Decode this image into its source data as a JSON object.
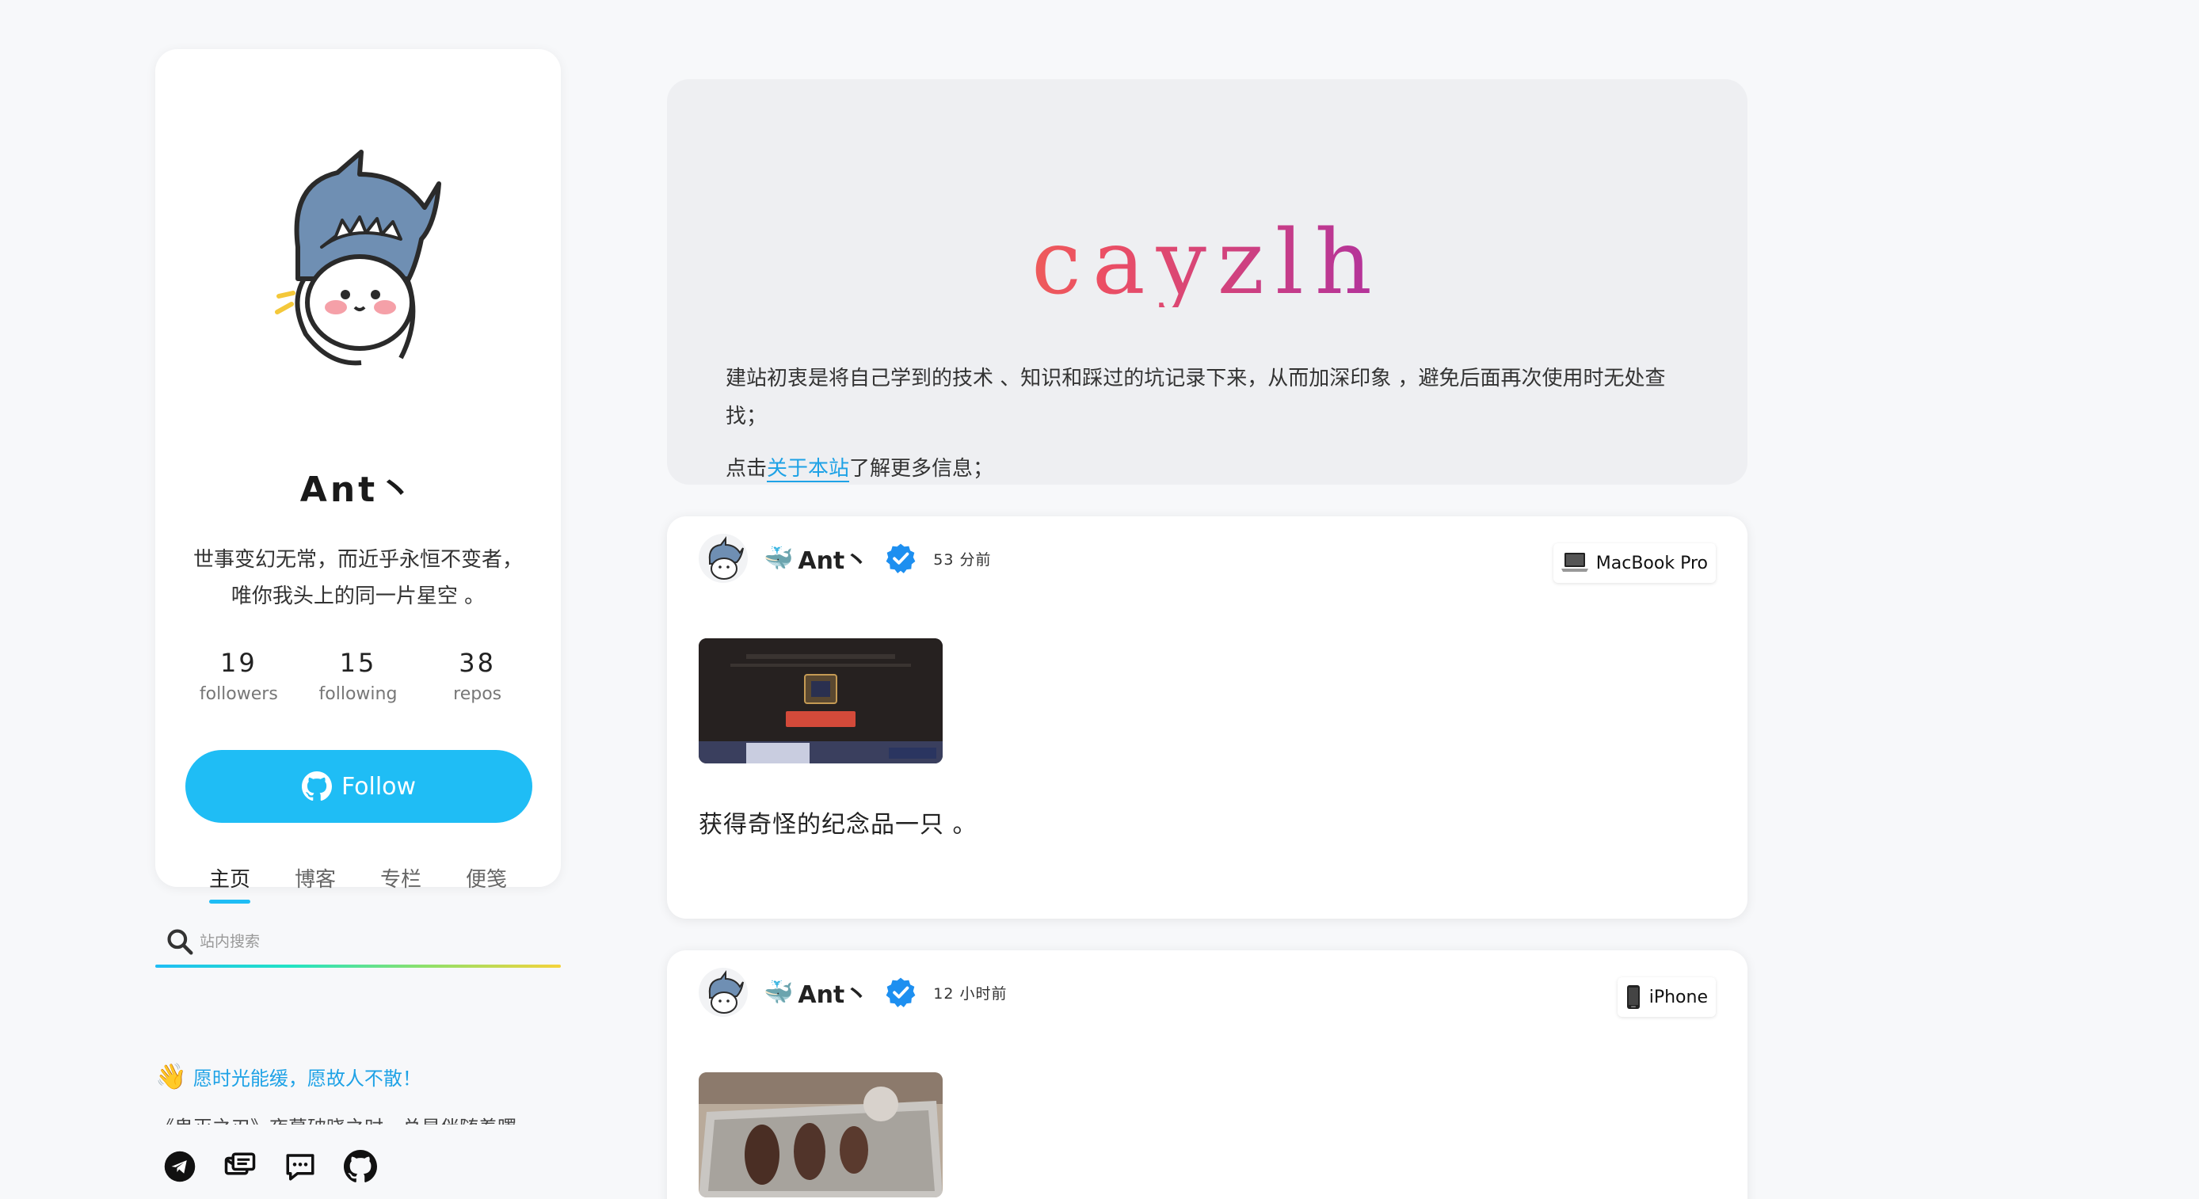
{
  "profile": {
    "name": "Ant丶",
    "bio_line1": "世事变幻无常，而近乎永恒不变者，",
    "bio_line2": "唯你我头上的同一片星空 。",
    "stats": [
      {
        "num": "19",
        "label": "followers"
      },
      {
        "num": "15",
        "label": "following"
      },
      {
        "num": "38",
        "label": "repos"
      }
    ],
    "follow_label": "Follow",
    "tabs": [
      {
        "label": "主页",
        "active": true
      },
      {
        "label": "博客",
        "active": false
      },
      {
        "label": "专栏",
        "active": false
      },
      {
        "label": "便笺",
        "active": false
      }
    ]
  },
  "search": {
    "placeholder": "站内搜索"
  },
  "quote": {
    "text": "愿时光能缓，愿故人不散！",
    "sub": "《鬼灭之刃》夜幕破晓之时，总是伴随着曙"
  },
  "socials": [
    "telegram-icon",
    "mail-icon",
    "chat-icon",
    "github-icon"
  ],
  "header": {
    "title": "cayzlh",
    "desc": "建站初衷是将自己学到的技术 、知识和踩过的坑记录下来，从而加深印象 ，避免后面再次使用时无处查找；",
    "desc2_pre": "点击",
    "desc2_link": "关于本站",
    "desc2_post": "了解更多信息；"
  },
  "posts": [
    {
      "author": "Ant丶",
      "time": "53 分前",
      "device": "MacBook Pro",
      "text": "获得奇怪的纪念品一只 。"
    },
    {
      "author": "Ant丶",
      "time": "12 小时前",
      "device": "iPhone",
      "text": ""
    }
  ],
  "colors": {
    "accent": "#1fbdf5",
    "link": "#1ea2e6",
    "title_gradient": [
      "#f79b2c",
      "#ec4f63",
      "#a92ea5",
      "#6a1bc1"
    ]
  }
}
